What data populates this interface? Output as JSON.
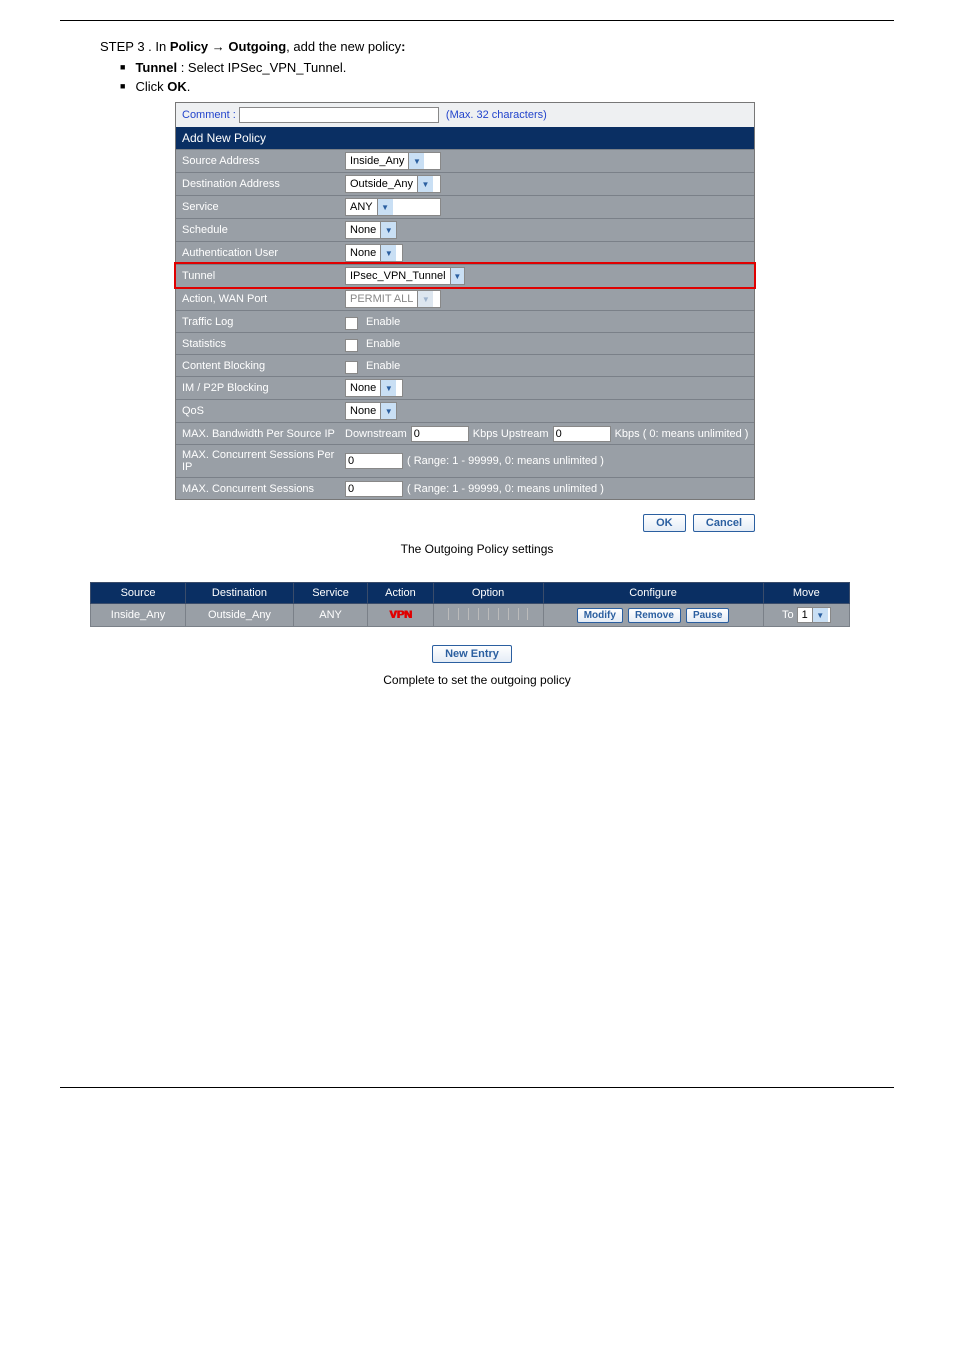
{
  "paper": {
    "step_text": "STEP 3 . In Policy   Outgoing, add the new policy:",
    "bullets": [
      "Tunnel : Select IPSec_VPN_Tunnel.",
      "Click OK."
    ],
    "caption1": "The Outgoing Policy settings",
    "caption2": "Complete to set the outgoing policy"
  },
  "form": {
    "comment_label": "Comment :",
    "comment_value": "",
    "comment_hint": "(Max. 32 characters)",
    "title": "Add New Policy",
    "rows": {
      "source": "Source Address",
      "dest": "Destination Address",
      "service": "Service",
      "schedule": "Schedule",
      "auth": "Authentication User",
      "tunnel": "Tunnel",
      "action": "Action, WAN Port",
      "traffic": "Traffic Log",
      "stats": "Statistics",
      "content": "Content Blocking",
      "imp2p": "IM / P2P Blocking",
      "qos": "QoS",
      "maxbw": "MAX. Bandwidth Per Source IP",
      "maxses_ip": "MAX. Concurrent Sessions Per IP",
      "maxses": "MAX. Concurrent Sessions"
    },
    "values": {
      "source": "Inside_Any",
      "dest": "Outside_Any",
      "service": "ANY",
      "schedule": "None",
      "auth": "None",
      "tunnel": "IPsec_VPN_Tunnel",
      "action": "PERMIT ALL",
      "enable": "Enable",
      "imp2p": "None",
      "qos": "None",
      "downstream_label": "Downstream",
      "downstream": "0",
      "kbps_upstream_label": "Kbps Upstream",
      "upstream": "0",
      "kbps_hint": "Kbps ( 0: means unlimited )",
      "sessions_ip": "0",
      "sessions": "0",
      "range_hint": "( Range: 1 - 99999, 0: means unlimited )"
    },
    "buttons": {
      "ok": "OK",
      "cancel": "Cancel"
    }
  },
  "table": {
    "headers": {
      "source": "Source",
      "dest": "Destination",
      "service": "Service",
      "action": "Action",
      "option": "Option",
      "configure": "Configure",
      "move": "Move"
    },
    "row": {
      "source": "Inside_Any",
      "dest": "Outside_Any",
      "service": "ANY",
      "action": "VPN",
      "modify": "Modify",
      "remove": "Remove",
      "pause": "Pause",
      "to": "To",
      "move_val": "1"
    },
    "new_entry": "New Entry"
  }
}
